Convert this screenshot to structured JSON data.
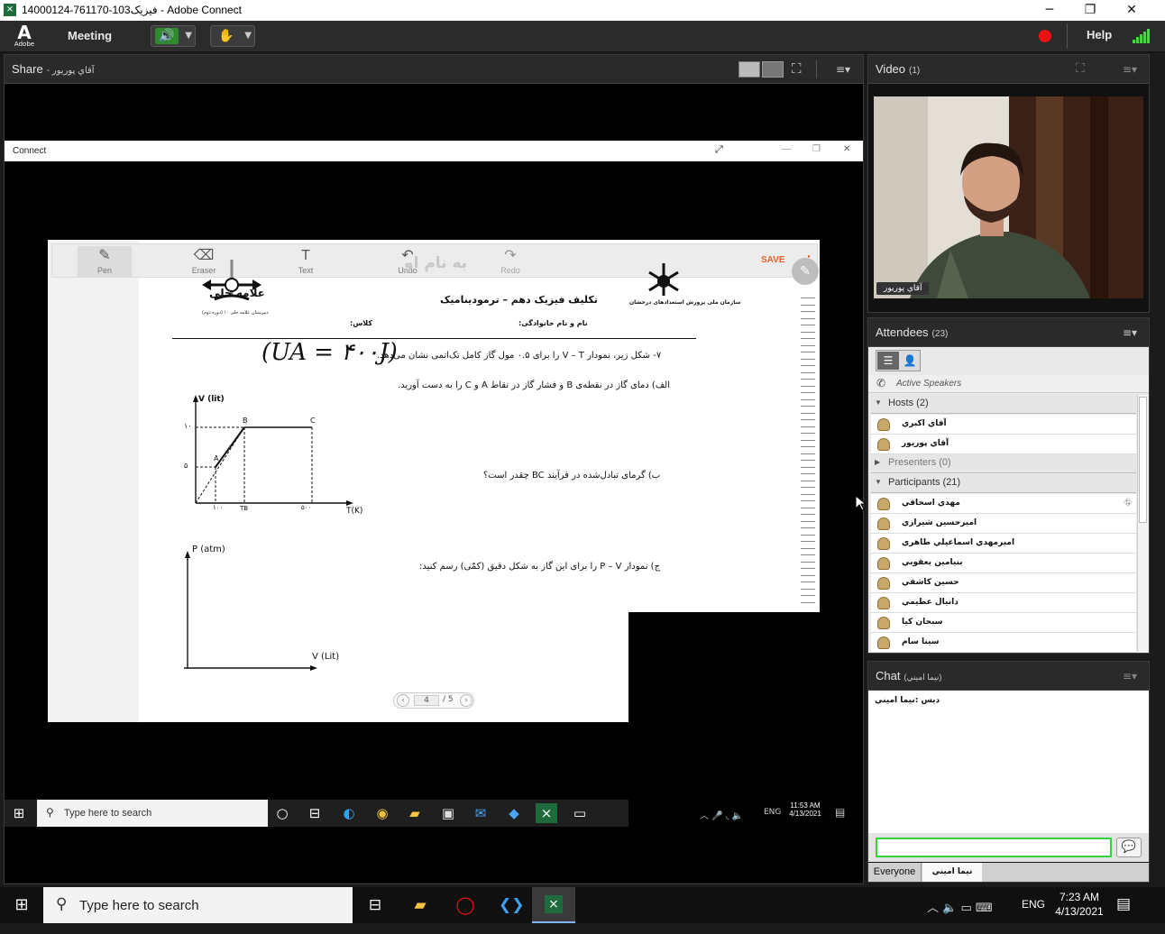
{
  "window": {
    "title": "14000124-761170-103فیزیک - Adobe Connect",
    "app_icon": "adobe-connect-icon",
    "minimize": "─",
    "maximize": "❐",
    "close": "✕"
  },
  "menubar": {
    "logo": "Adobe",
    "meeting": "Meeting",
    "help": "Help"
  },
  "share_pod": {
    "title": "Share",
    "subtitle": "- آقاي پوريور"
  },
  "connect_window": {
    "title": "Connect"
  },
  "whiteboard_toolbar": {
    "pen": "Pen",
    "eraser": "Eraser",
    "text": "Text",
    "undo": "Undo",
    "redo": "Redo",
    "save": "SAVE"
  },
  "document": {
    "watermark": "به نام او",
    "header_title": "تکلیف  فیزیک دهم  –  ترمودینامیک",
    "name_field": "نام و نام خانوادگی:",
    "class_field": "کلاس:",
    "school_logo_text": "علامه حلی",
    "school_sub": "دبیرستان علامه حلی ۱۰ (دوره دوم)",
    "org_logo_text": "سازمان ملی پرورش استعدادهای درخشان",
    "handwriting": "(UA = ۴۰۰J)",
    "q7": "۷- شکل زیر، نمودار V – T را برای ۰.۵ مول گاز کامل تک‌اتمی نشان می‌دهد.",
    "q7a": "الف) دمای گاز در نقطه‌ی B و فشار گاز در نقاط A و C را به دست آورید.",
    "q7b": "ب) گرمای تبادل‌شده در فرآیند BC چقدر است؟",
    "q7c": "ج) نمودار P – V را برای این گاز به شکل دقیق (کمّی) رسم کنید:",
    "graph1": {
      "y_label": "V (lit)",
      "x_label": "T(K)",
      "y_ticks": [
        "۱۰",
        "۵"
      ],
      "x_ticks": [
        "۱۰۰",
        "TB",
        "۵۰۰"
      ],
      "points": [
        "A",
        "B",
        "C"
      ]
    },
    "graph2": {
      "y_label": "P (atm)",
      "x_label": "V (Lit)"
    },
    "page_current": "4",
    "page_total": "/ 5"
  },
  "inner_taskbar": {
    "search": "Type here to search",
    "lang": "ENG",
    "time": "11:53 AM",
    "date": "4/13/2021"
  },
  "video_pod": {
    "title": "Video",
    "count": "(1)",
    "name_tag": "آقاي پوريور"
  },
  "attendees_pod": {
    "title": "Attendees",
    "count": "(23)",
    "active_speakers": "Active Speakers",
    "hosts_label": "Hosts (2)",
    "hosts": [
      "آقاي اکبري",
      "آقاي پوريور"
    ],
    "presenters_label": "Presenters (0)",
    "participants_label": "Participants (21)",
    "participants": [
      "مهدي اسحاقي",
      "اميرحسين شيرازي",
      "اميرمهدي اسماعيلي طاهري",
      "بنيامين يعقوبي",
      "حسين کاشفي",
      "دانيال عظيمي",
      "سبحان کيا",
      "سينا سام"
    ]
  },
  "chat_pod": {
    "title": "Chat",
    "subtitle": "(نيما اميني)",
    "message": "دیس :نيما اميني",
    "tab_everyone": "Everyone",
    "tab_private": "نيما اميني"
  },
  "taskbar": {
    "search": "Type here to search",
    "lang": "ENG",
    "time": "7:23 AM",
    "date": "4/13/2021"
  }
}
